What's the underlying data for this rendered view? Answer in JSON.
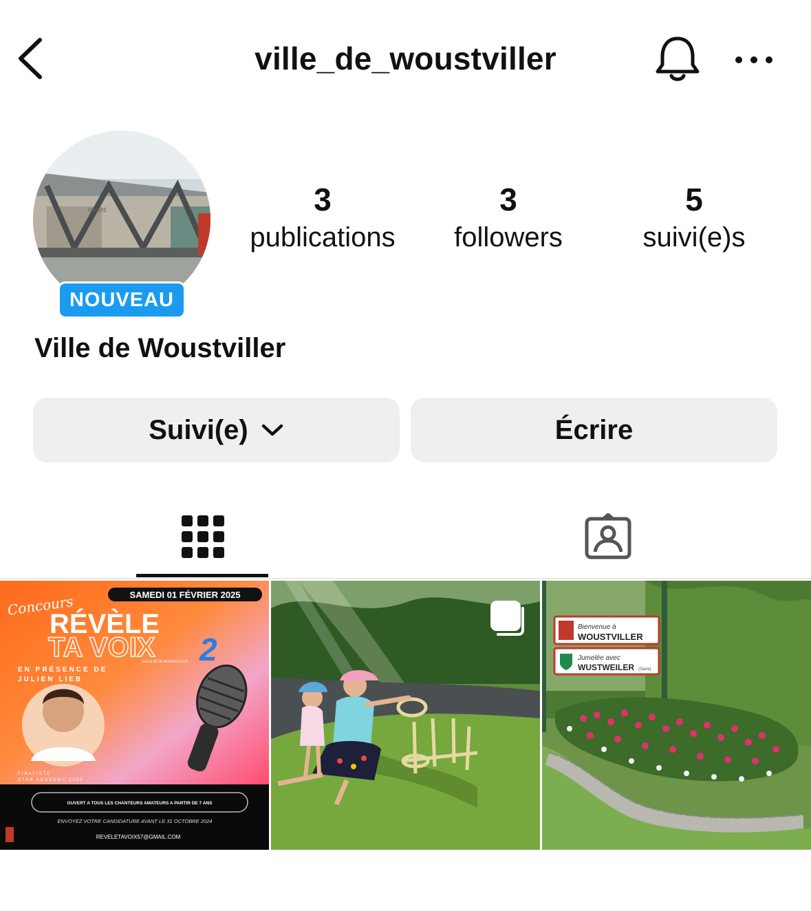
{
  "header": {
    "username": "ville_de_woustviller"
  },
  "profile": {
    "badge": "NOUVEAU",
    "display_name": "Ville de Woustviller",
    "avatar_sign_text": "MAIRIE"
  },
  "stats": [
    {
      "value": "3",
      "label": "publications"
    },
    {
      "value": "3",
      "label": "followers"
    },
    {
      "value": "5",
      "label": "suivi(e)s"
    }
  ],
  "actions": {
    "follow_label": "Suivi(e)",
    "message_label": "Écrire"
  },
  "tabs": {
    "active": "grid",
    "items": [
      "grid-icon",
      "tagged-icon"
    ]
  },
  "posts": [
    {
      "type": "poster",
      "lines": {
        "date": "SAMEDI 01 FÉVRIER 2025",
        "concours": "Concours",
        "title1": "RÉVÈLE",
        "title2": "TA VOIX",
        "title_num": "2",
        "venue": "SALLE W DE WOUSTVILLER",
        "presence1": "EN PRÉSENCE DE",
        "presence2": "JULIEN LIEB",
        "finalist1": "FINALISTE",
        "finalist2": "STAR ACADEMY 2023",
        "open": "OUVERT A TOUS LES CHANTEURS AMATEURS A PARTIR DE 7 ANS",
        "deadline": "ENVOYEZ VOTRE CANDIDATURE AVANT LE 31 OCTOBRE 2024",
        "email": "REVELETAVOIX57@GMAIL.COM"
      }
    },
    {
      "type": "photo",
      "multi": true,
      "description_icon": "carousel-icon"
    },
    {
      "type": "photo",
      "sign": {
        "line1a": "Bienvenue à",
        "line1b": "WOUSTVILLER",
        "line2a": "Jumelée avec",
        "line2b": "WUSTWEILER",
        "line2c": "(Sarre)"
      }
    }
  ],
  "colors": {
    "badge": "#1a9bf0",
    "button_bg": "#efeff1",
    "text": "#111111"
  }
}
